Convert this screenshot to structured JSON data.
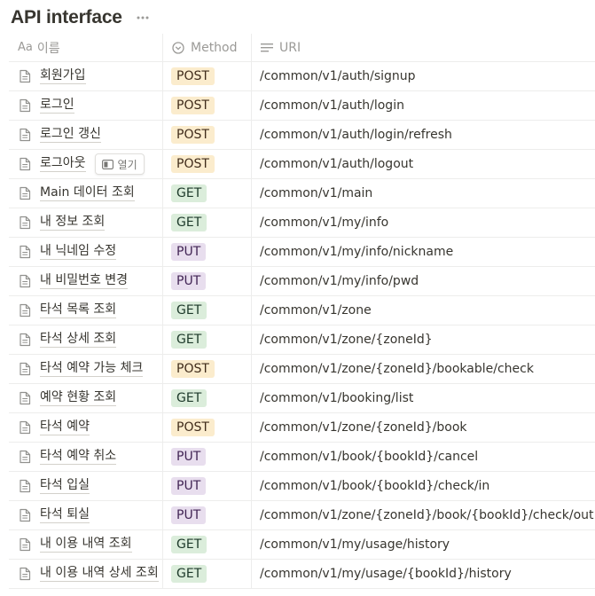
{
  "page": {
    "title": "API interface",
    "more_icon": "ellipsis-icon"
  },
  "colors": {
    "POST": "#fbeccd",
    "GET": "#dbeddb",
    "PUT": "#e8deee"
  },
  "columns": {
    "name": {
      "label": "이름",
      "prefix": "Aa",
      "icon": "title-property-icon"
    },
    "method": {
      "label": "Method",
      "icon": "select-property-icon"
    },
    "uri": {
      "label": "URI",
      "icon": "text-property-icon"
    }
  },
  "open_button": {
    "label": "열기",
    "icon": "open-as-page-icon"
  },
  "rows": [
    {
      "name": "회원가입",
      "method": "POST",
      "uri": "/common/v1/auth/signup"
    },
    {
      "name": "로그인",
      "method": "POST",
      "uri": "/common/v1/auth/login"
    },
    {
      "name": "로그인 갱신",
      "method": "POST",
      "uri": "/common/v1/auth/login/refresh"
    },
    {
      "name": "로그아웃",
      "method": "POST",
      "uri": "/common/v1/auth/logout",
      "hover": true
    },
    {
      "name": "Main 데이터 조회",
      "method": "GET",
      "uri": "/common/v1/main"
    },
    {
      "name": "내 정보 조회",
      "method": "GET",
      "uri": "/common/v1/my/info"
    },
    {
      "name": "내 닉네임 수정",
      "method": "PUT",
      "uri": "/common/v1/my/info/nickname"
    },
    {
      "name": "내 비밀번호 변경",
      "method": "PUT",
      "uri": "/common/v1/my/info/pwd"
    },
    {
      "name": "타석 목록 조회",
      "method": "GET",
      "uri": "/common/v1/zone"
    },
    {
      "name": "타석 상세 조회",
      "method": "GET",
      "uri": "/common/v1/zone/{zoneId}"
    },
    {
      "name": "타석 예약 가능 체크",
      "method": "POST",
      "uri": "/common/v1/zone/{zoneId}/bookable/check"
    },
    {
      "name": "예약 현황 조회",
      "method": "GET",
      "uri": "/common/v1/booking/list"
    },
    {
      "name": "타석 예약",
      "method": "POST",
      "uri": "/common/v1/zone/{zoneId}/book"
    },
    {
      "name": "타석 예약 취소",
      "method": "PUT",
      "uri": "/common/v1/book/{bookId}/cancel"
    },
    {
      "name": "타석 입실",
      "method": "PUT",
      "uri": "/common/v1/book/{bookId}/check/in"
    },
    {
      "name": "타석 퇴실",
      "method": "PUT",
      "uri": "/common/v1/zone/{zoneId}/book/{bookId}/check/out"
    },
    {
      "name": "내 이용 내역 조회",
      "method": "GET",
      "uri": "/common/v1/my/usage/history"
    },
    {
      "name": "내 이용 내역 상세 조회",
      "method": "GET",
      "uri": "/common/v1/my/usage/{bookId}/history"
    }
  ]
}
